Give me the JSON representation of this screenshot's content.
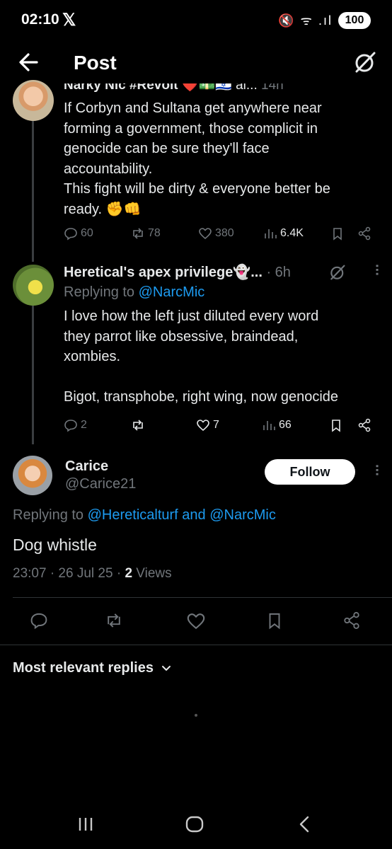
{
  "status_bar": {
    "time": "02:10",
    "app_glyph": "𝕏",
    "icons": "🔇 ᯤ .ıl",
    "battery": "100"
  },
  "topbar": {
    "title": "Post",
    "back_icon": "arrow-left-icon",
    "grok_icon": "grok-icon"
  },
  "tweet1": {
    "header_partial": "Narky Nic #Revolt",
    "emojis": "❤️💵🇮🇱 al...",
    "time_partial": "14h",
    "lines": [
      "If Corbyn and Sultana get anywhere near",
      "forming a government, those complicit in",
      "genocide can be sure they'll face",
      "accountability.",
      "This fight will be dirty & everyone better be",
      "ready. ✊👊"
    ],
    "stats": {
      "replies": "60",
      "reposts": "78",
      "likes": "380",
      "views": "6.4K"
    }
  },
  "tweet2": {
    "name": "Heretical's apex privilege👻...",
    "time": "· 6h",
    "replying_prefix": "Replying to",
    "replying_to": "@NarcMic",
    "lines": [
      "I love how the left just diluted every word",
      "they parrot like obsessive, braindead,",
      "xombies.",
      "",
      "Bigot, transphobe, right wing, now genocide"
    ],
    "stats": {
      "replies": "2",
      "reposts": "",
      "likes": "7",
      "views": "66"
    }
  },
  "main_post": {
    "name": "Carice",
    "handle": "@Carice21",
    "follow_label": "Follow",
    "replying_prefix": "Replying to",
    "replying_to": "@Hereticalturf and @NarcMic",
    "text": "Dog whistle",
    "meta_time": "23:07 · 26 Jul 25 ·",
    "views_count": "2",
    "views_label": "Views"
  },
  "replies_sort": {
    "label": "Most relevant replies",
    "chevron": "⌄"
  },
  "colors": {
    "background": "#000000",
    "text": "#e7e9ea",
    "muted": "#71767b",
    "link": "#1d9bf0",
    "divider": "#2f3336"
  }
}
